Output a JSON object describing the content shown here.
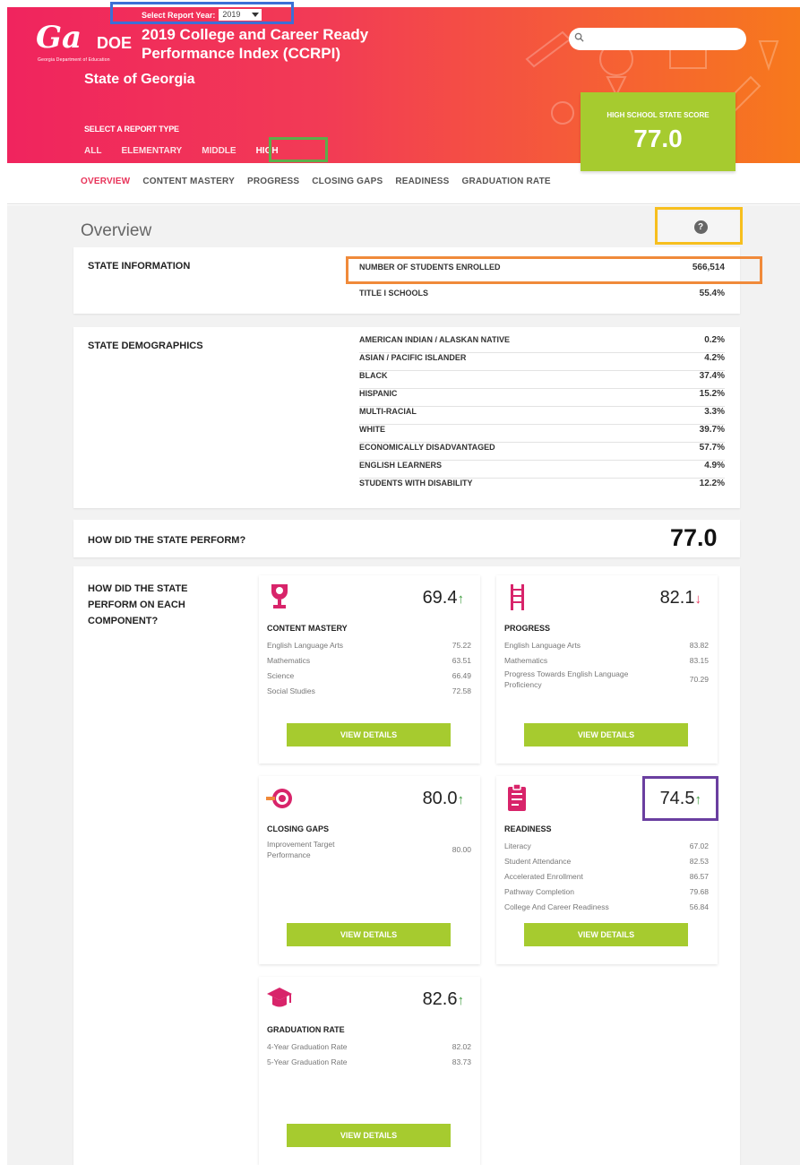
{
  "header": {
    "logo_text": "GaDOE",
    "logo_subtext": "Georgia Department of Education",
    "year_label": "Select Report Year:",
    "year_value": "2019",
    "title": "2019 College and Career Ready Performance Index (CCRPI)",
    "state_name": "State of Georgia",
    "report_type_label": "SELECT A REPORT TYPE",
    "report_types": [
      "ALL",
      "ELEMENTARY",
      "MIDDLE",
      "HIGH"
    ],
    "active_report_type": "HIGH",
    "search_placeholder": "",
    "score_label": "HIGH SCHOOL STATE SCORE",
    "score_value": "77.0"
  },
  "subnav": [
    "OVERVIEW",
    "CONTENT MASTERY",
    "PROGRESS",
    "CLOSING GAPS",
    "READINESS",
    "GRADUATION RATE"
  ],
  "overview_title": "Overview",
  "help_icon": "question-circle-icon",
  "state_info": {
    "title": "STATE INFORMATION",
    "rows": [
      {
        "label": "NUMBER OF STUDENTS ENROLLED",
        "value": "566,514"
      },
      {
        "label": "TITLE I SCHOOLS",
        "value": "55.4%"
      }
    ]
  },
  "demographics": {
    "title": "STATE DEMOGRAPHICS",
    "rows": [
      {
        "label": "AMERICAN INDIAN / ALASKAN NATIVE",
        "value": "0.2%"
      },
      {
        "label": "ASIAN / PACIFIC ISLANDER",
        "value": "4.2%"
      },
      {
        "label": "BLACK",
        "value": "37.4%"
      },
      {
        "label": "HISPANIC",
        "value": "15.2%"
      },
      {
        "label": "MULTI-RACIAL",
        "value": "3.3%"
      },
      {
        "label": "WHITE",
        "value": "39.7%"
      },
      {
        "label": "ECONOMICALLY DISADVANTAGED",
        "value": "57.7%"
      },
      {
        "label": "ENGLISH LEARNERS",
        "value": "4.9%"
      },
      {
        "label": "STUDENTS WITH DISABILITY",
        "value": "12.2%"
      }
    ]
  },
  "performance": {
    "title": "HOW DID THE STATE PERFORM?",
    "score": "77.0",
    "components_label": "HOW DID THE STATE PERFORM ON EACH COMPONENT?",
    "view_details_label": "VIEW DETAILS",
    "components": [
      {
        "name": "CONTENT MASTERY",
        "score": "69.4",
        "trend": "up",
        "trend_glyph": "↑",
        "icon": "trophy-icon",
        "items": [
          {
            "label": "English Language Arts",
            "value": "75.22"
          },
          {
            "label": "Mathematics",
            "value": "63.51"
          },
          {
            "label": "Science",
            "value": "66.49"
          },
          {
            "label": "Social Studies",
            "value": "72.58"
          }
        ]
      },
      {
        "name": "PROGRESS",
        "score": "82.1",
        "trend": "down",
        "trend_glyph": "↓",
        "icon": "ladder-icon",
        "items": [
          {
            "label": "English Language Arts",
            "value": "83.82"
          },
          {
            "label": "Mathematics",
            "value": "83.15"
          },
          {
            "label": "Progress Towards English Language Proficiency",
            "value": "70.29"
          }
        ]
      },
      {
        "name": "CLOSING GAPS",
        "score": "80.0",
        "trend": "up",
        "trend_glyph": "↑",
        "icon": "target-icon",
        "items": [
          {
            "label": "Improvement Target Performance",
            "value": "80.00"
          }
        ]
      },
      {
        "name": "READINESS",
        "score": "74.5",
        "trend": "up",
        "trend_glyph": "↑",
        "icon": "clipboard-icon",
        "items": [
          {
            "label": "Literacy",
            "value": "67.02"
          },
          {
            "label": "Student Attendance",
            "value": "82.53"
          },
          {
            "label": "Accelerated Enrollment",
            "value": "86.57"
          },
          {
            "label": "Pathway Completion",
            "value": "79.68"
          },
          {
            "label": "College And Career Readiness",
            "value": "56.84"
          }
        ]
      },
      {
        "name": "GRADUATION RATE",
        "score": "82.6",
        "trend": "up",
        "trend_glyph": "↑",
        "icon": "graduation-cap-icon",
        "items": [
          {
            "label": "4-Year Graduation Rate",
            "value": "82.02"
          },
          {
            "label": "5-Year Graduation Rate",
            "value": "83.73"
          }
        ]
      }
    ]
  },
  "colors": {
    "header_gradient_start": "#f0245e",
    "header_gradient_end": "#f7791c",
    "accent_green": "#a6cb2f",
    "accent_pink": "#e8345a",
    "trend_up": "#3a9a3a",
    "highlight_blue": "#3c6fd6",
    "highlight_green": "#5cae4a",
    "highlight_yellow": "#f7bf1e",
    "highlight_orange": "#f08a3a",
    "highlight_purple": "#6a3fa0"
  }
}
